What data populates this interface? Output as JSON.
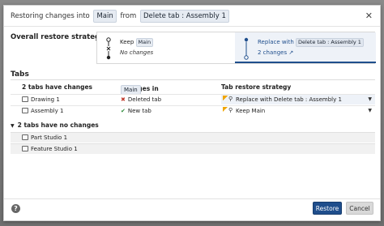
{
  "dialog": {
    "title_prefix": "Restoring changes into",
    "title_target": "Main",
    "title_from": "from",
    "title_source": "Delete tab : Assembly 1"
  },
  "strategy": {
    "label": "Overall restore strategy",
    "keep": {
      "label": "Keep",
      "chip": "Main",
      "sub": "No changes"
    },
    "replace": {
      "label": "Replace with",
      "chip": "Delete tab : Assembly 1",
      "sub": "2 changes"
    }
  },
  "tabs": {
    "title": "Tabs",
    "headers": {
      "changed": "2 tabs have changes",
      "changes_in": "Changes in",
      "changes_in_chip": "Main",
      "strategy": "Tab restore strategy"
    },
    "changed_rows": [
      {
        "name": "Drawing 1",
        "change": "Deleted tab",
        "strategy": "Replace with Delete tab : Assembly 1"
      },
      {
        "name": "Assembly 1",
        "change": "New tab",
        "strategy": "Keep Main"
      }
    ],
    "unchanged_label": "2 tabs have no changes",
    "unchanged_rows": [
      {
        "name": "Part Studio 1"
      },
      {
        "name": "Feature Studio 1"
      }
    ]
  },
  "footer": {
    "help": "?",
    "restore": "Restore",
    "cancel": "Cancel"
  },
  "colors": {
    "primary": "#1f4e8c",
    "selected_bg": "#eef2f8",
    "deleted": "#c0392b",
    "added": "#2e8b3a"
  }
}
